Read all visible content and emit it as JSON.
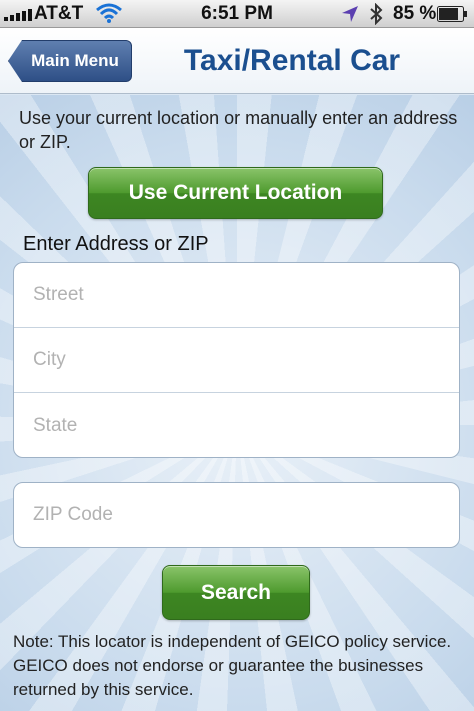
{
  "status_bar": {
    "carrier": "AT&T",
    "time": "6:51 PM",
    "battery_percent": "85 %",
    "icons": [
      "signal-bars-icon",
      "wifi-icon",
      "location-arrow-icon",
      "bluetooth-icon",
      "battery-icon"
    ]
  },
  "nav": {
    "back_label": "Main Menu",
    "title": "Taxi/Rental Car"
  },
  "content": {
    "intro": "Use your current location or manually enter an address or ZIP.",
    "current_location_button": "Use Current Location",
    "address_label": "Enter Address or ZIP",
    "fields": {
      "street": {
        "value": "",
        "placeholder": "Street"
      },
      "city": {
        "value": "",
        "placeholder": "City"
      },
      "state": {
        "value": "",
        "placeholder": "State"
      },
      "zip": {
        "value": "",
        "placeholder": "ZIP Code"
      }
    },
    "search_button": "Search",
    "note": "Note: This locator is independent of GEICO policy service.  GEICO does not endorse or guarantee the businesses returned by this service."
  },
  "colors": {
    "nav_title": "#1b4f8f",
    "back_button": "#2e4f86",
    "green_button": "#4e9a2e",
    "background": "#c9dbed"
  }
}
